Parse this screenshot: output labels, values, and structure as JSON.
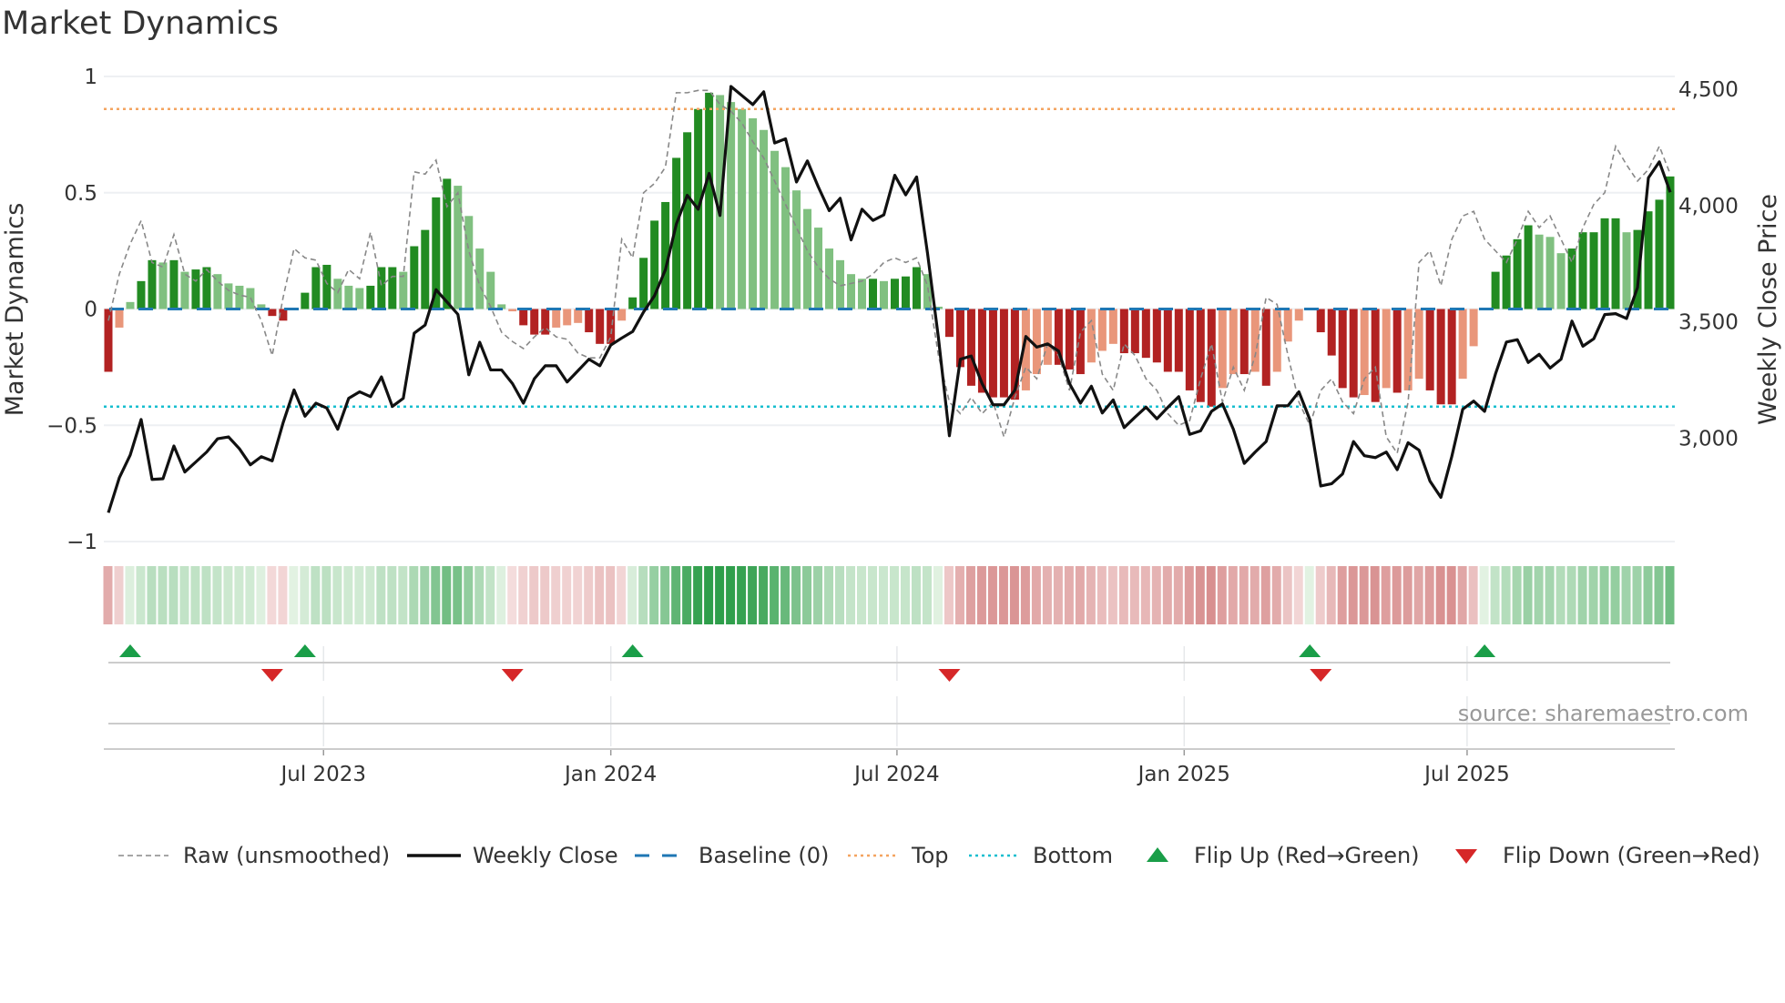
{
  "title": "Market Dynamics",
  "source": "source: sharemaestro.com",
  "colors": {
    "green_strong": "#228b22",
    "green_weak": "#80c080",
    "red_strong": "#b22222",
    "red_weak": "#e9967a",
    "close": "#111111",
    "raw": "#888888",
    "baseline": "#1f77b4",
    "top": "#f4a460",
    "bottom": "#17becf",
    "flip_up": "#1a9e48",
    "flip_down": "#d62728"
  },
  "chart_data": {
    "type": "bar+line",
    "title": "Market Dynamics",
    "ylabel": "Market Dynamics",
    "y2label": "Weekly Close Price",
    "ylim": [
      -1,
      1
    ],
    "y2lim": [
      2555,
      4555
    ],
    "yticks": [
      {
        "v": 1,
        "label": "1"
      },
      {
        "v": 0.5,
        "label": "0.5"
      },
      {
        "v": 0,
        "label": "0"
      },
      {
        "v": -0.5,
        "label": "−0.5"
      },
      {
        "v": -1,
        "label": "−1"
      }
    ],
    "y2ticks": [
      {
        "v": 4500,
        "label": "4,500"
      },
      {
        "v": 4000,
        "label": "4,000"
      },
      {
        "v": 3500,
        "label": "3,500"
      },
      {
        "v": 3000,
        "label": "3,000"
      }
    ],
    "xticks": [
      {
        "week": 19.7,
        "label": "Jul 2023"
      },
      {
        "week": 46,
        "label": "Jan 2024"
      },
      {
        "week": 72.2,
        "label": "Jul 2024"
      },
      {
        "week": 98.5,
        "label": "Jan 2025"
      },
      {
        "week": 124.4,
        "label": "Jul 2025"
      }
    ],
    "top_level": 0.86,
    "bottom_level": -0.42,
    "baseline": 0,
    "dynamics": [
      -0.27,
      -0.08,
      0.03,
      0.12,
      0.21,
      0.2,
      0.21,
      0.16,
      0.17,
      0.18,
      0.15,
      0.11,
      0.1,
      0.09,
      0.02,
      -0.03,
      -0.05,
      0,
      0.07,
      0.18,
      0.19,
      0.13,
      0.1,
      0.09,
      0.1,
      0.18,
      0.18,
      0.16,
      0.27,
      0.34,
      0.48,
      0.56,
      0.53,
      0.4,
      0.26,
      0.16,
      0.02,
      -0.01,
      -0.07,
      -0.11,
      -0.11,
      -0.08,
      -0.07,
      -0.06,
      -0.1,
      -0.15,
      -0.15,
      -0.05,
      0.05,
      0.22,
      0.38,
      0.46,
      0.65,
      0.76,
      0.86,
      0.93,
      0.92,
      0.89,
      0.86,
      0.82,
      0.77,
      0.68,
      0.61,
      0.51,
      0.43,
      0.35,
      0.26,
      0.21,
      0.15,
      0.13,
      0.13,
      0.12,
      0.13,
      0.14,
      0.18,
      0.15,
      0.01,
      -0.12,
      -0.25,
      -0.33,
      -0.36,
      -0.38,
      -0.38,
      -0.39,
      -0.35,
      -0.28,
      -0.24,
      -0.24,
      -0.26,
      -0.28,
      -0.23,
      -0.18,
      -0.15,
      -0.19,
      -0.19,
      -0.21,
      -0.23,
      -0.27,
      -0.27,
      -0.35,
      -0.4,
      -0.42,
      -0.34,
      -0.28,
      -0.28,
      -0.27,
      -0.33,
      -0.27,
      -0.14,
      -0.05,
      0.0,
      -0.1,
      -0.2,
      -0.34,
      -0.38,
      -0.37,
      -0.4,
      -0.34,
      -0.36,
      -0.35,
      -0.3,
      -0.35,
      -0.41,
      -0.41,
      -0.3,
      -0.16,
      0.0,
      0.16,
      0.23,
      0.3,
      0.36,
      0.32,
      0.31,
      0.24,
      0.26,
      0.33,
      0.33,
      0.39,
      0.39,
      0.33,
      0.34,
      0.42,
      0.47,
      0.57
    ],
    "raw": [
      -0.05,
      0.15,
      0.28,
      0.38,
      0.2,
      0.18,
      0.32,
      0.15,
      0.12,
      0.17,
      0.12,
      0.08,
      0.06,
      0.05,
      -0.05,
      -0.2,
      0.05,
      0.26,
      0.22,
      0.21,
      0.11,
      0.07,
      0.17,
      0.13,
      0.33,
      0.1,
      0.14,
      0.14,
      0.59,
      0.58,
      0.64,
      0.44,
      0.5,
      0.25,
      0.1,
      0.01,
      -0.1,
      -0.14,
      -0.17,
      -0.12,
      -0.08,
      -0.12,
      -0.13,
      -0.19,
      -0.21,
      -0.21,
      -0.12,
      0.3,
      0.22,
      0.5,
      0.54,
      0.61,
      0.93,
      0.93,
      0.94,
      0.94,
      0.88,
      0.85,
      0.8,
      0.72,
      0.65,
      0.55,
      0.45,
      0.35,
      0.25,
      0.18,
      0.13,
      0.1,
      0.11,
      0.12,
      0.15,
      0.2,
      0.22,
      0.2,
      0.22,
      0.1,
      -0.2,
      -0.4,
      -0.45,
      -0.38,
      -0.45,
      -0.4,
      -0.55,
      -0.38,
      -0.25,
      -0.3,
      -0.15,
      -0.2,
      -0.35,
      -0.1,
      -0.05,
      -0.28,
      -0.35,
      -0.15,
      -0.2,
      -0.3,
      -0.35,
      -0.45,
      -0.5,
      -0.48,
      -0.3,
      -0.15,
      -0.4,
      -0.25,
      -0.35,
      -0.2,
      0.05,
      0.02,
      -0.2,
      -0.4,
      -0.5,
      -0.35,
      -0.3,
      -0.4,
      -0.45,
      -0.3,
      -0.25,
      -0.55,
      -0.62,
      -0.4,
      0.2,
      0.25,
      0.1,
      0.3,
      0.4,
      0.42,
      0.3,
      0.25,
      0.2,
      0.3,
      0.42,
      0.35,
      0.4,
      0.3,
      0.2,
      0.35,
      0.45,
      0.5,
      0.7,
      0.62,
      0.55,
      0.6,
      0.7,
      0.58
    ],
    "close": [
      2679,
      2829,
      2927,
      3080,
      2822,
      2825,
      2966,
      2854,
      2897,
      2940,
      2997,
      3005,
      2954,
      2885,
      2920,
      2902,
      3066,
      3207,
      3094,
      3150,
      3129,
      3038,
      3171,
      3199,
      3178,
      3263,
      3136,
      3171,
      3451,
      3486,
      3638,
      3585,
      3532,
      3272,
      3412,
      3293,
      3293,
      3234,
      3150,
      3255,
      3311,
      3311,
      3241,
      3290,
      3339,
      3311,
      3400,
      3430,
      3458,
      3542,
      3612,
      3724,
      3920,
      4044,
      3984,
      4138,
      3957,
      4512,
      4473,
      4434,
      4489,
      4269,
      4287,
      4101,
      4192,
      4080,
      3978,
      4031,
      3852,
      3984,
      3936,
      3960,
      4130,
      4046,
      4123,
      3794,
      3430,
      3010,
      3339,
      3353,
      3234,
      3143,
      3143,
      3206,
      3437,
      3391,
      3405,
      3374,
      3234,
      3150,
      3223,
      3108,
      3164,
      3045,
      3090,
      3133,
      3083,
      3132,
      3178,
      3016,
      3031,
      3115,
      3147,
      3038,
      2891,
      2940,
      2985,
      3139,
      3139,
      3199,
      3080,
      2794,
      2804,
      2846,
      2985,
      2924,
      2916,
      2940,
      2864,
      2980,
      2948,
      2815,
      2745,
      2921,
      3124,
      3159,
      3115,
      3276,
      3413,
      3423,
      3325,
      3360,
      3301,
      3339,
      3503,
      3395,
      3427,
      3531,
      3535,
      3514,
      3647,
      4119,
      4188,
      4057
    ],
    "flip_up_weeks": [
      2,
      18,
      48,
      110,
      126
    ],
    "flip_down_weeks": [
      15,
      37,
      77,
      111
    ],
    "legend": [
      {
        "key": "raw",
        "label": "Raw (unsmoothed)"
      },
      {
        "key": "close",
        "label": "Weekly Close"
      },
      {
        "key": "baseline",
        "label": "Baseline (0)"
      },
      {
        "key": "top",
        "label": "Top"
      },
      {
        "key": "bottom",
        "label": "Bottom"
      },
      {
        "key": "flip_up",
        "label": "Flip Up (Red→Green)"
      },
      {
        "key": "flip_down",
        "label": "Flip Down (Green→Red)"
      }
    ],
    "legend_position": "bottom"
  }
}
